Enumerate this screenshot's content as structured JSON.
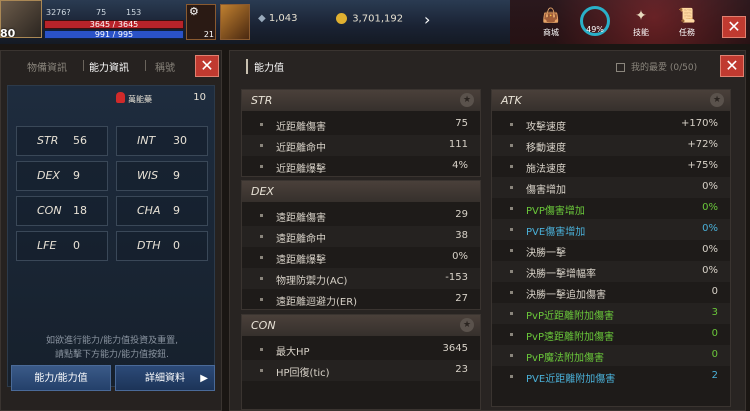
{
  "hud": {
    "level": "80",
    "stat_a": "3276?",
    "stat_b": "75",
    "stat_c": "153",
    "hp": "3645 / 3645",
    "mp": "991 / 995",
    "potion_count": "21",
    "currency_a": "1,043",
    "gold": "3,701,192",
    "menu": [
      {
        "label": "商城",
        "icon": "bag-icon"
      },
      {
        "label": "技能",
        "icon": "skill-icon"
      },
      {
        "label": "任務",
        "icon": "scroll-icon"
      }
    ],
    "exp_percent": "49%"
  },
  "left_panel": {
    "tabs": [
      "物備資訊",
      "能力資訊",
      "稱號"
    ],
    "active_tab": 1,
    "points_label": "萬能藥",
    "points_value": "10",
    "stats": [
      {
        "name": "STR",
        "value": "56"
      },
      {
        "name": "INT",
        "value": "30"
      },
      {
        "name": "DEX",
        "value": "9"
      },
      {
        "name": "WIS",
        "value": "9"
      },
      {
        "name": "CON",
        "value": "18"
      },
      {
        "name": "CHA",
        "value": "9"
      },
      {
        "name": "LFE",
        "value": "0"
      },
      {
        "name": "DTH",
        "value": "0"
      }
    ],
    "hint_line1": "如欲進行能力/能力值投資及重置,",
    "hint_line2": "請點擊下方能力/能力值按鈕.",
    "btn_stats": "能力/能力值",
    "btn_detail": "詳細資料"
  },
  "right_panel": {
    "title": "能力值",
    "favorites": "我的最愛 (0/50)",
    "sections_left": [
      {
        "title": "STR",
        "rows": [
          {
            "label": "近距離傷害",
            "value": "75"
          },
          {
            "label": "近距離命中",
            "value": "111"
          },
          {
            "label": "近距離爆擊",
            "value": "4%"
          }
        ]
      },
      {
        "title": "DEX",
        "rows": [
          {
            "label": "遠距離傷害",
            "value": "29"
          },
          {
            "label": "遠距離命中",
            "value": "38"
          },
          {
            "label": "遠距離爆擊",
            "value": "0%"
          },
          {
            "label": "物理防禦力(AC)",
            "value": "-153"
          },
          {
            "label": "遠距離迴避力(ER)",
            "value": "27"
          }
        ]
      },
      {
        "title": "CON",
        "rows": [
          {
            "label": "最大HP",
            "value": "3645"
          },
          {
            "label": "HP回復(tic)",
            "value": "23"
          }
        ]
      }
    ],
    "section_right": {
      "title": "ATK",
      "rows": [
        {
          "label": "攻擊速度",
          "value": "+170%",
          "color": ""
        },
        {
          "label": "移動速度",
          "value": "+72%",
          "color": ""
        },
        {
          "label": "施法速度",
          "value": "+75%",
          "color": ""
        },
        {
          "label": "傷害增加",
          "value": "0%",
          "color": ""
        },
        {
          "label": "PVP傷害增加",
          "value": "0%",
          "color": "green"
        },
        {
          "label": "PVE傷害增加",
          "value": "0%",
          "color": "teal"
        },
        {
          "label": "決勝一擊",
          "value": "0%",
          "color": ""
        },
        {
          "label": "決勝一擊增幅率",
          "value": "0%",
          "color": ""
        },
        {
          "label": "決勝一擊追加傷害",
          "value": "0",
          "color": ""
        },
        {
          "label": "PvP近距離附加傷害",
          "value": "3",
          "color": "green"
        },
        {
          "label": "PvP遠距離附加傷害",
          "value": "0",
          "color": "green"
        },
        {
          "label": "PvP魔法附加傷害",
          "value": "0",
          "color": "green"
        },
        {
          "label": "PVE近距離附加傷害",
          "value": "2",
          "color": "teal"
        }
      ]
    }
  }
}
